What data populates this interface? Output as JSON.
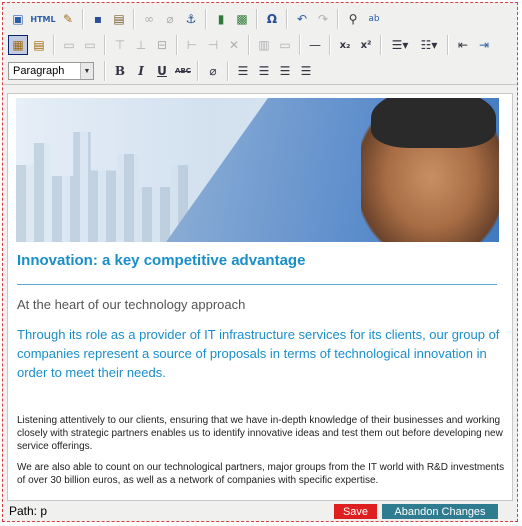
{
  "toolbar": {
    "row1": [
      {
        "name": "preview-icon",
        "glyph": "▣"
      },
      {
        "name": "html-source-icon",
        "glyph": "HTML"
      },
      {
        "name": "cleanup-icon",
        "glyph": "🧹"
      },
      {
        "name": "save-icon",
        "glyph": "💾"
      },
      {
        "name": "paste-word-icon",
        "glyph": "📋"
      },
      {
        "name": "link-icon",
        "glyph": "⛓"
      },
      {
        "name": "unlink-icon",
        "glyph": "⛓"
      },
      {
        "name": "anchor-icon",
        "glyph": "⚓"
      },
      {
        "name": "media-icon",
        "glyph": "🎞"
      },
      {
        "name": "image-icon",
        "glyph": "🖼"
      },
      {
        "name": "special-char-icon",
        "glyph": "Ω"
      },
      {
        "name": "undo-icon",
        "glyph": "↶"
      },
      {
        "name": "redo-icon",
        "glyph": "↷"
      },
      {
        "name": "find-icon",
        "glyph": "🔭"
      },
      {
        "name": "replace-icon",
        "glyph": "⇄"
      }
    ],
    "row2": [
      {
        "name": "table-icon",
        "glyph": "▦"
      },
      {
        "name": "table-props-icon",
        "glyph": "▤"
      },
      {
        "name": "row-props-icon",
        "glyph": "▭"
      },
      {
        "name": "cell-props-icon",
        "glyph": "▭"
      },
      {
        "name": "insert-row-before-icon",
        "glyph": "⊤"
      },
      {
        "name": "insert-row-after-icon",
        "glyph": "⊥"
      },
      {
        "name": "delete-row-icon",
        "glyph": "⊟"
      },
      {
        "name": "insert-col-before-icon",
        "glyph": "⊢"
      },
      {
        "name": "insert-col-after-icon",
        "glyph": "⊣"
      },
      {
        "name": "delete-col-icon",
        "glyph": "✕"
      },
      {
        "name": "split-cells-icon",
        "glyph": "▥"
      },
      {
        "name": "merge-cells-icon",
        "glyph": "▭"
      },
      {
        "name": "horizontal-rule-icon",
        "glyph": "—"
      },
      {
        "name": "subscript-icon",
        "glyph": "x₂"
      },
      {
        "name": "superscript-icon",
        "glyph": "x²"
      },
      {
        "name": "numbered-list-icon",
        "glyph": "≡"
      },
      {
        "name": "bullet-list-icon",
        "glyph": "≡"
      },
      {
        "name": "outdent-icon",
        "glyph": "⇤"
      },
      {
        "name": "indent-icon",
        "glyph": "⇥"
      }
    ],
    "format_select": "Paragraph",
    "row3": [
      {
        "name": "bold-icon",
        "glyph": "B"
      },
      {
        "name": "italic-icon",
        "glyph": "I"
      },
      {
        "name": "underline-icon",
        "glyph": "U"
      },
      {
        "name": "strikethrough-icon",
        "glyph": "ABC"
      },
      {
        "name": "remove-format-icon",
        "glyph": "⌫"
      },
      {
        "name": "align-left-icon",
        "glyph": "≡"
      },
      {
        "name": "align-center-icon",
        "glyph": "≡"
      },
      {
        "name": "align-right-icon",
        "glyph": "≡"
      },
      {
        "name": "align-justify-icon",
        "glyph": "≡"
      }
    ]
  },
  "content": {
    "heading": "Innovation: a key competitive advantage",
    "subheading": "At the heart of our technology approach",
    "lead": "Through its role as a provider of IT infrastructure services for its clients, our group of companies represent a source of proposals in terms of technological innovation in order to meet their needs.",
    "paragraph1": "Listening attentively to our clients, ensuring that we have in-depth knowledge of their businesses and working closely with strategic partners enables us to identify innovative ideas and test them out before developing new service offerings.",
    "paragraph2": "We are also able to count on our technological partners, major groups from the IT world with R&D investments of over 30 billion euros, as well as a network of companies with specific expertise."
  },
  "status": {
    "path": "Path: p",
    "save_label": "Save",
    "abandon_label": "Abandon Changes"
  }
}
